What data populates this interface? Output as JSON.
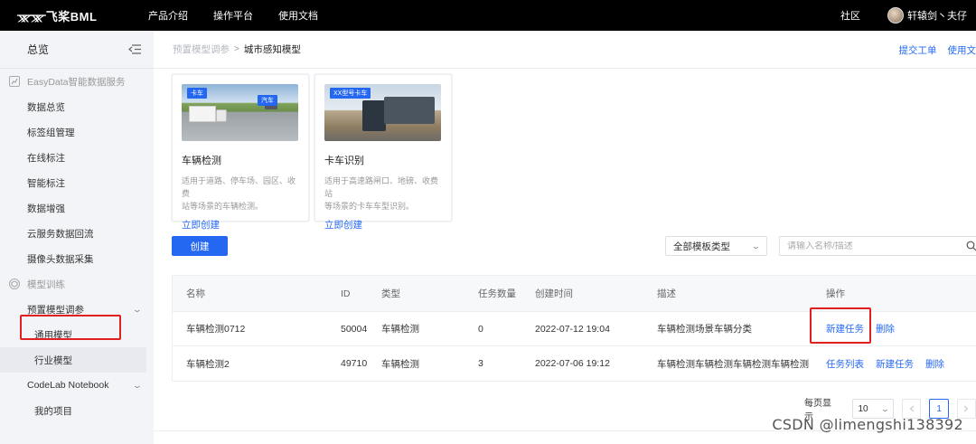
{
  "brand": {
    "logo_mark": "ᚘᚘ",
    "name": "飞桨BML"
  },
  "topnav": {
    "items": [
      "产品介绍",
      "操作平台",
      "使用文档"
    ],
    "community": "社区",
    "username": "轩辕剑丶夫仔"
  },
  "sidebar": {
    "title": "总览",
    "section_easydata": "EasyData智能数据服务",
    "easydata_items": [
      "数据总览",
      "标签组管理",
      "在线标注",
      "智能标注",
      "数据增强",
      "云服务数据回流",
      "摄像头数据采集"
    ],
    "section_training": "模型训练",
    "group_preset": "预置模型调参",
    "preset_items": [
      "通用模型",
      "行业模型"
    ],
    "group_codelab": "CodeLab Notebook",
    "codelab_items": [
      "我的项目"
    ]
  },
  "breadcrumb": {
    "prev": "预置模型调参",
    "sep": ">",
    "current": "城市感知模型"
  },
  "header_links": {
    "submit_ticket": "提交工单",
    "docs": "使用文"
  },
  "cards": [
    {
      "tag1": "卡车",
      "tag2": "汽车",
      "title": "车辆检测",
      "desc_line1": "适用于道路、停车场、园区、收费",
      "desc_line2": "站等场景的车辆检测。",
      "link": "立即创建"
    },
    {
      "tag1": "XX型号卡车",
      "title": "卡车识别",
      "desc_line1": "适用于高速路闸口、地磅、收费站",
      "desc_line2": "等场景的卡车车型识别。",
      "link": "立即创建"
    }
  ],
  "toolbar": {
    "create": "创建",
    "type_filter": "全部模板类型",
    "search_placeholder": "请输入名称/描述"
  },
  "table": {
    "headers": [
      "名称",
      "ID",
      "类型",
      "任务数量",
      "创建时间",
      "描述",
      "操作"
    ],
    "rows": [
      {
        "name": "车辆检测0712",
        "id": "50004",
        "type": "车辆检测",
        "tasks": "0",
        "created": "2022-07-12 19:04",
        "desc": "车辆检测场景车辆分类",
        "ops": [
          "新建任务",
          "删除"
        ]
      },
      {
        "name": "车辆检测2",
        "id": "49710",
        "type": "车辆检测",
        "tasks": "3",
        "created": "2022-07-06 19:12",
        "desc": "车辆检测车辆检测车辆检测车辆检测",
        "ops": [
          "任务列表",
          "新建任务",
          "删除"
        ]
      }
    ]
  },
  "pagination": {
    "per_page_label": "每页显示",
    "page_size": "10",
    "current_page": "1"
  },
  "watermark": "CSDN @limengshi138392",
  "colors": {
    "accent": "#2468f2",
    "highlight": "#e02020",
    "topbar": "#000000"
  }
}
